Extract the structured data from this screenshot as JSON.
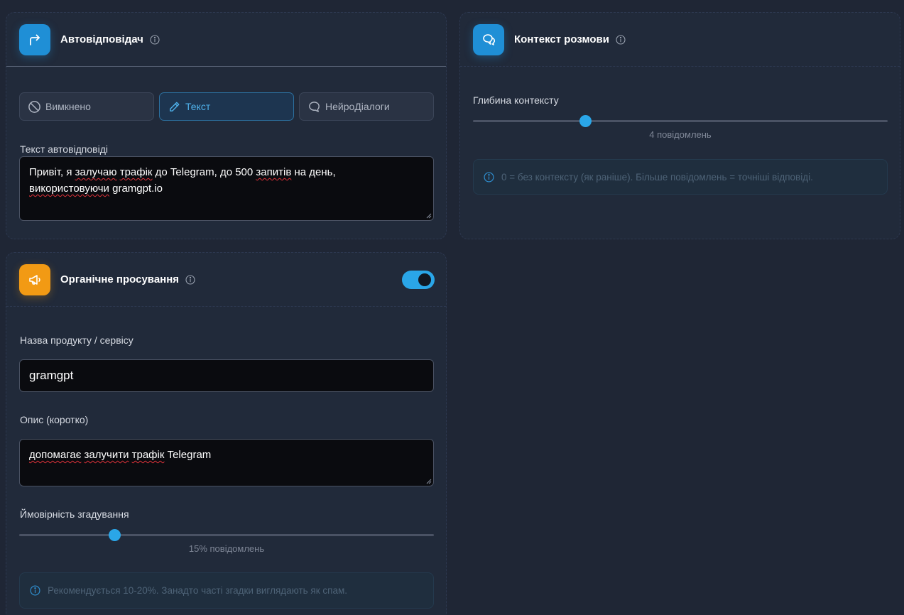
{
  "autoresponder": {
    "title": "Автовідповідач",
    "modes": [
      {
        "label": "Вимкнено",
        "icon": "block-icon",
        "active": false
      },
      {
        "label": "Текст",
        "icon": "pencil-icon",
        "active": true
      },
      {
        "label": "НейроДіалоги",
        "icon": "chat-icon",
        "active": false
      }
    ],
    "text_label": "Текст автовідповіді",
    "text_line1_a": "Привіт, я ",
    "text_line1_b": "залучаю",
    "text_line1_c": " ",
    "text_line1_d": "трафік",
    "text_line1_e": " до Telegram, до 500 ",
    "text_line1_f": "запитів",
    "text_line1_g": " на день,",
    "text_line2_a": "використовуючи",
    "text_line2_b": " gramgpt.io"
  },
  "context": {
    "title": "Контекст розмови",
    "depth_label": "Глибина контексту",
    "depth_value_text": "4 повідомлень",
    "depth_fraction": 0.27,
    "hint": "0 = без контексту (як раніше). Більше повідомлень = точніші відповіді."
  },
  "organic": {
    "title": "Органічне просування",
    "enabled": true,
    "product_label": "Назва продукту / сервісу",
    "product_value": "gramgpt",
    "desc_label": "Опис (коротко)",
    "desc_value_a": "допомагає",
    "desc_value_b": " ",
    "desc_value_c": "залучити",
    "desc_value_d": " ",
    "desc_value_e": "трафік",
    "desc_value_f": " Telegram",
    "prob_label": "Ймовірність згадування",
    "prob_value_text": "15% повідомлень",
    "prob_fraction": 0.23,
    "hint": "Рекомендується 10-20%. Занадто часті згадки виглядають як спам."
  },
  "colors": {
    "accent": "#2aa6e8",
    "icon_blue": "#1f8fd6",
    "icon_orange": "#f29a14"
  }
}
